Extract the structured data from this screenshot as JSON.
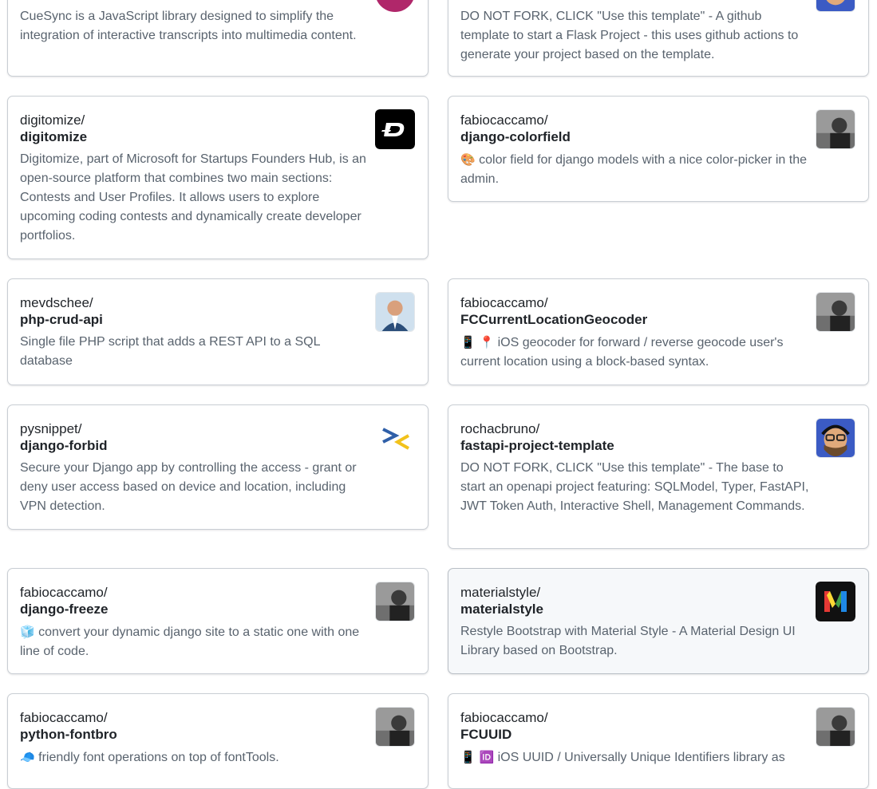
{
  "cards": [
    {
      "id": "cuesync",
      "owner": "",
      "repo": "",
      "description": "CueSync is a JavaScript library designed to simplify the integration of interactive transcripts into multimedia content.",
      "avatar": "cuesync-logo"
    },
    {
      "id": "flask-template",
      "owner": "",
      "repo": "",
      "description": "DO NOT FORK, CLICK \"Use this template\" - A github template to start a Flask Project - this uses github actions to generate your project based on the template.",
      "avatar": "rochacbruno-avatar"
    },
    {
      "id": "digitomize",
      "owner": "digitomize/",
      "repo": "digitomize",
      "description": "Digitomize, part of Microsoft for Startups Founders Hub, is an open-source platform that combines two main sections: Contests and User Profiles. It allows users to explore upcoming coding contests and dynamically create developer portfolios.",
      "avatar": "digitomize-logo"
    },
    {
      "id": "django-colorfield",
      "owner": "fabiocaccamo/",
      "repo": "django-colorfield",
      "emoji": "🎨",
      "description": "color field for django models with a nice color-picker in the admin.",
      "avatar": "fabiocaccamo-avatar"
    },
    {
      "id": "php-crud-api",
      "owner": "mevdschee/",
      "repo": "php-crud-api",
      "description": "Single file PHP script that adds a REST API to a SQL database",
      "avatar": "mevdschee-avatar"
    },
    {
      "id": "fccurrentlocationgeocoder",
      "owner": "fabiocaccamo/",
      "repo": "FCCurrentLocationGeocoder",
      "emoji": "📱 📍",
      "description": "iOS geocoder for forward / reverse geocode user's current location using a block-based syntax.",
      "avatar": "fabiocaccamo-avatar"
    },
    {
      "id": "django-forbid",
      "owner": "pysnippet/",
      "repo": "django-forbid",
      "description": "Secure your Django app by controlling the access - grant or deny user access based on device and location, including VPN detection.",
      "avatar": "pysnippet-logo"
    },
    {
      "id": "fastapi-project-template",
      "owner": "rochacbruno/",
      "repo": "fastapi-project-template",
      "description": "DO NOT FORK, CLICK \"Use this template\" - The base to start an openapi project featuring: SQLModel, Typer, FastAPI, JWT Token Auth, Interactive Shell, Management Commands.",
      "avatar": "rochacbruno-avatar"
    },
    {
      "id": "django-freeze",
      "owner": "fabiocaccamo/",
      "repo": "django-freeze",
      "emoji": "🧊",
      "description": "convert your dynamic django site to a static one with one line of code.",
      "avatar": "fabiocaccamo-avatar"
    },
    {
      "id": "materialstyle",
      "owner": "materialstyle/",
      "repo": "materialstyle",
      "description": "Restyle Bootstrap with Material Style - A Material Design UI Library based on Bootstrap.",
      "avatar": "materialstyle-logo"
    },
    {
      "id": "python-fontbro",
      "owner": "fabiocaccamo/",
      "repo": "python-fontbro",
      "emoji": "🧢",
      "description": "friendly font operations on top of fontTools.",
      "avatar": "fabiocaccamo-avatar"
    },
    {
      "id": "fcuuid",
      "owner": "fabiocaccamo/",
      "repo": "FCUUID",
      "emoji": "📱 🆔",
      "description": "iOS UUID / Universally Unique Identifiers library as",
      "avatar": "fabiocaccamo-avatar"
    }
  ],
  "colors": {
    "card_border": "#c9ced4",
    "card_hover_bg": "#f6f8fa",
    "description_text": "#59636e",
    "title_text": "#1f2328"
  }
}
